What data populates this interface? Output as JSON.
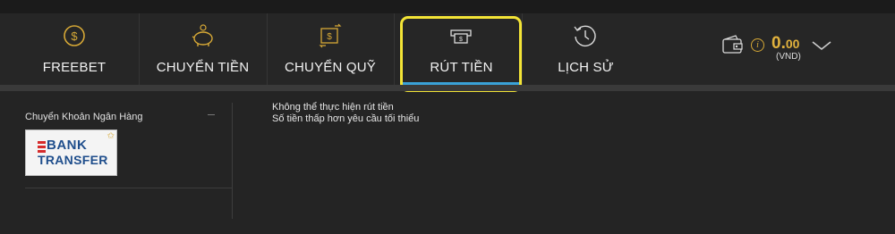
{
  "nav": {
    "tabs": [
      {
        "id": "freebet",
        "label": "FREEBET",
        "icon": "dollar-coin-icon"
      },
      {
        "id": "chuyen-tien",
        "label": "CHUYỂN TIỀN",
        "icon": "piggy-bank-icon"
      },
      {
        "id": "chuyen-quy",
        "label": "CHUYỂN QUỸ",
        "icon": "transfer-icon"
      },
      {
        "id": "rut-tien",
        "label": "RÚT TIỀN",
        "icon": "cash-withdraw-icon",
        "active": true
      },
      {
        "id": "lich-su",
        "label": "LỊCH SỬ",
        "icon": "history-clock-icon"
      }
    ]
  },
  "wallet": {
    "balance_int": "0.",
    "balance_dec": "00",
    "currency": "(VND)",
    "info": "i"
  },
  "colors": {
    "accent_gold": "#e1b23d",
    "active_tab_underline": "#3aa2d8",
    "highlight_outline": "#f3e436",
    "bank_blue": "#1f4e8c",
    "bank_red": "#d62b2b"
  },
  "payment_methods": {
    "title": "Chuyển Khoản Ngân Hàng",
    "bank_card": {
      "line1": "BANK",
      "line2": "TRANSFER",
      "star": "✩"
    }
  },
  "message": {
    "line1": "Không thể thực hiện rút tiền",
    "line2": "Số tiền thấp hơn yêu cầu tối thiểu"
  }
}
